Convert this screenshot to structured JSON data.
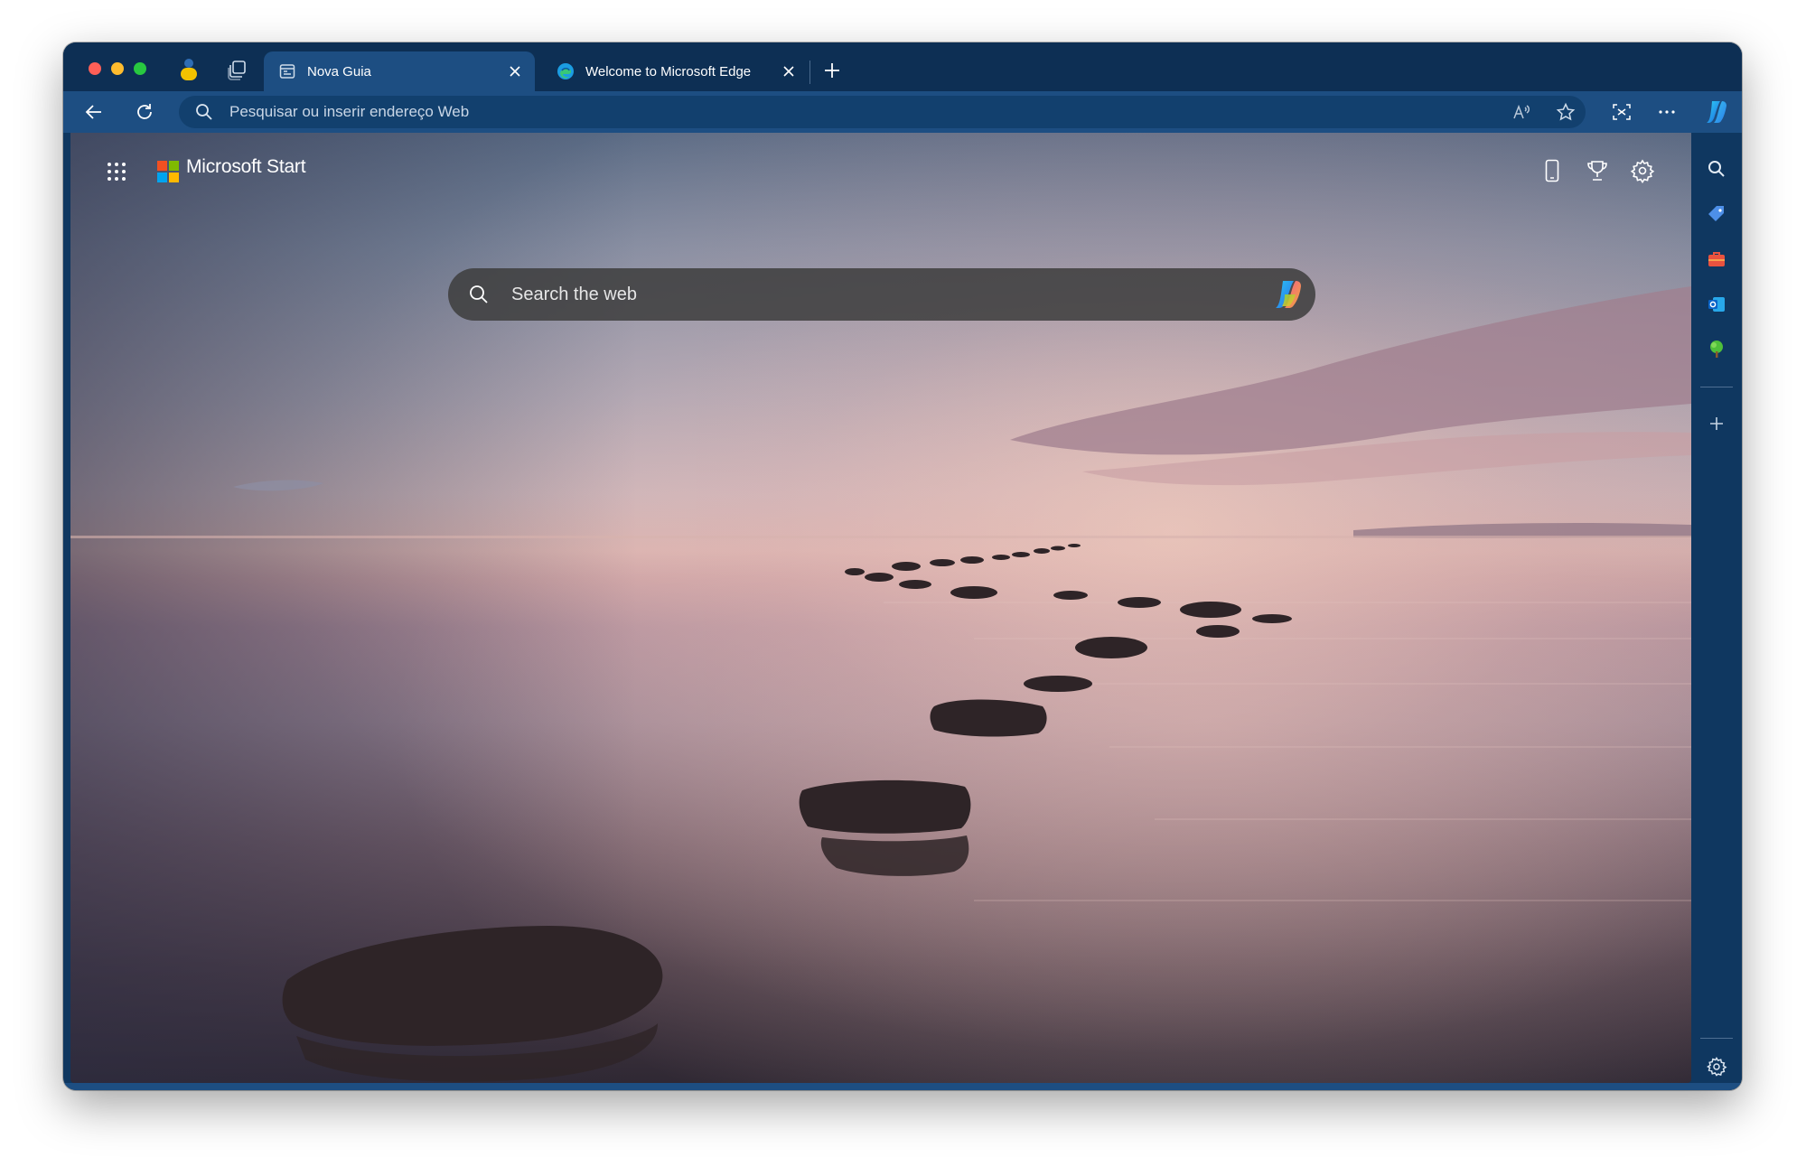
{
  "window": {
    "traffic_lights": [
      "close",
      "minimize",
      "zoom"
    ]
  },
  "tabs": [
    {
      "label": "Nova Guia",
      "active": true,
      "icon": "new-tab-page-icon"
    },
    {
      "label": "Welcome to Microsoft Edge",
      "active": false,
      "icon": "edge-logo-icon"
    }
  ],
  "toolbar": {
    "address_placeholder": "Pesquisar ou inserir endereço Web",
    "icons": [
      "back-arrow-icon",
      "refresh-icon",
      "read-aloud-icon",
      "favorite-star-icon",
      "screenshot-icon",
      "more-options-icon",
      "copilot-icon"
    ]
  },
  "page": {
    "brand": "Microsoft Start",
    "search_placeholder": "Search the web",
    "header_icons": [
      "mobile-phone-icon",
      "rewards-trophy-icon",
      "settings-gear-icon"
    ]
  },
  "sidebar": {
    "items": [
      "search-icon",
      "shopping-tag-icon",
      "tools-briefcase-icon",
      "outlook-icon",
      "tree-icon",
      "add-icon",
      "settings-gear-icon"
    ]
  },
  "colors": {
    "tabstrip": "#0d2f54",
    "toolbar": "#1d4e82",
    "accent_red": "#fe5f57",
    "accent_yellow": "#febc2e",
    "accent_green": "#28c840"
  }
}
